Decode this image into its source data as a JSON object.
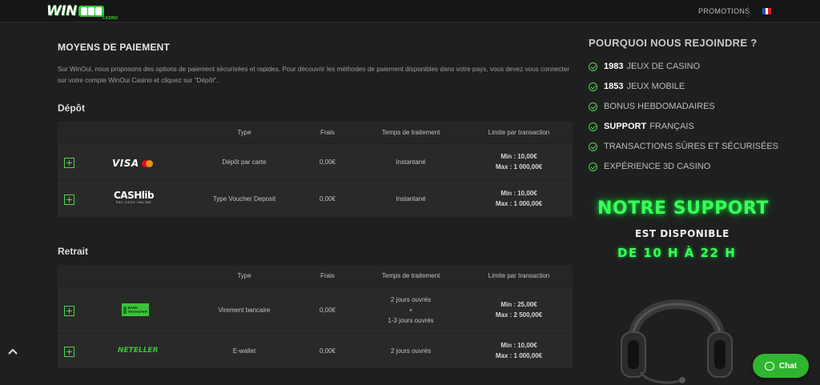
{
  "header": {
    "logo_text": "WIN",
    "logo_sub": "CASINO",
    "promotions": "PROMOTIONS",
    "flag_colors": [
      "#1f4fb0",
      "#ffffff",
      "#d8202a"
    ]
  },
  "payments": {
    "title": "MOYENS DE PAIEMENT",
    "intro": "Sur WinOui, nous proposons des options de paiement sécurisées et rapides. Pour découvrir les méthodes de paiement disponibles dans votre pays, vous devez vous connecter sur votre compte WinOui Casino et cliquez sur \"Dépôt\".",
    "columns": {
      "type": "Type",
      "fees": "Frais",
      "processing": "Temps de traitement",
      "limit": "Limite par transaction"
    },
    "deposit": {
      "title": "Dépôt",
      "rows": [
        {
          "logo": "visa-mastercard",
          "logo_text": "VISA",
          "type": "Dépôt par carte",
          "fees": "0,00€",
          "processing": [
            "Instantané"
          ],
          "min": "Min : 10,00€",
          "max": "Max : 1 000,00€"
        },
        {
          "logo": "cashlib",
          "logo_text": "CASHlib",
          "logo_sub": "PAY CASH ONLINE",
          "type": "Type Voucher Deposit",
          "fees": "0,00€",
          "processing": [
            "Instantané"
          ],
          "min": "Min : 10,00€",
          "max": "Max : 1 000,00€"
        }
      ]
    },
    "withdrawal": {
      "title": "Retrait",
      "rows": [
        {
          "logo": "bank-transfer",
          "logo_text": "BANK TRANSFER",
          "type": "Virement bancaire",
          "fees": "0,00€",
          "processing": [
            "2 jours ouvrés",
            "+",
            "1-3 jours ouvrés"
          ],
          "min": "Min : 25,00€",
          "max": "Max : 2 500,00€"
        },
        {
          "logo": "neteller",
          "logo_text": "NETELLER",
          "type": "E-wallet",
          "fees": "0,00€",
          "processing": [
            "2 jours ouvrés"
          ],
          "min": "Min : 10,00€",
          "max": "Max : 1 000,00€"
        }
      ]
    }
  },
  "why": {
    "title": "POURQUOI NOUS REJOINDRE ?",
    "items": [
      {
        "bold": "1983",
        "text": "JEUX DE CASINO"
      },
      {
        "bold": "1853",
        "text": "JEUX MOBILE"
      },
      {
        "bold": "",
        "text": "BONUS HEBDOMADAIRES"
      },
      {
        "bold": "SUPPORT",
        "text": "FRANÇAIS"
      },
      {
        "bold": "",
        "text": "TRANSACTIONS SÛRES ET SÉCURISÉES"
      },
      {
        "bold": "",
        "text": "EXPÉRIENCE 3D CASINO"
      }
    ]
  },
  "support": {
    "title": "NOTRE SUPPORT",
    "subtitle": "EST DISPONIBLE",
    "hours": "DE 10 H À 22 H"
  },
  "chat": {
    "label": "Chat"
  },
  "colors": {
    "accent": "#3cc23c",
    "neon": "#39ff5a",
    "bg": "#1f1f1f",
    "row": "#292929"
  }
}
